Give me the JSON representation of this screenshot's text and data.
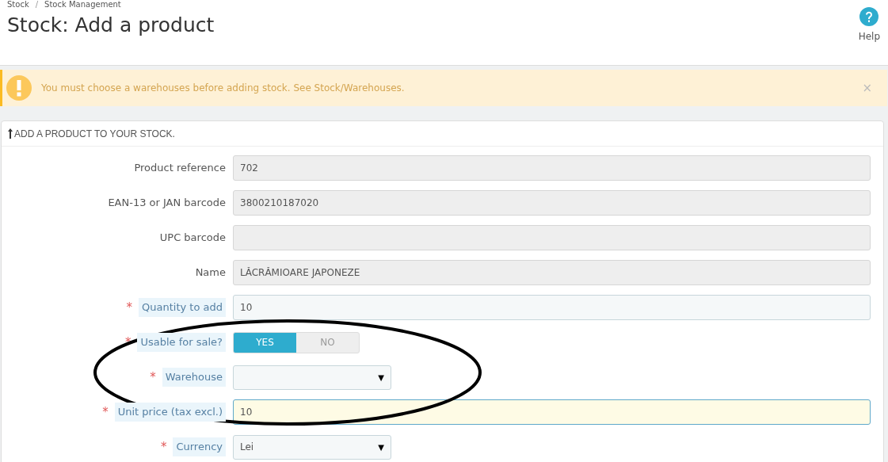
{
  "breadcrumb": [
    "Stock",
    "Stock Management"
  ],
  "breadcrumb_separator": "/",
  "required_mark": "*",
  "page_title": "Stock: Add a product",
  "help": {
    "label": "Help"
  },
  "alert": {
    "message": "You must choose a warehouses before adding stock. See Stock/Warehouses.",
    "close": "×"
  },
  "panel": {
    "title": "ADD A PRODUCT TO YOUR STOCK.",
    "fields": [
      {
        "kind": "text",
        "label": "Product reference",
        "required": false,
        "disabled": true,
        "focused": false,
        "value": "702"
      },
      {
        "kind": "text",
        "label": "EAN-13 or JAN barcode",
        "required": false,
        "disabled": true,
        "focused": false,
        "value": "3800210187020"
      },
      {
        "kind": "text",
        "label": "UPC barcode",
        "required": false,
        "disabled": true,
        "focused": false
      },
      {
        "kind": "text",
        "label": "Name",
        "required": false,
        "disabled": true,
        "focused": false,
        "value": "LĂCRĂMIOARE JAPONEZE"
      },
      {
        "kind": "text",
        "label": "Quantity to add",
        "required": true,
        "disabled": false,
        "focused": false,
        "value": "10"
      },
      {
        "kind": "switch",
        "label": "Usable for sale?",
        "required": true,
        "options": [
          {
            "label": "YES",
            "selected": true
          },
          {
            "label": "NO",
            "selected": false
          }
        ]
      },
      {
        "kind": "select",
        "label": "Warehouse",
        "required": true,
        "caret": "▼"
      },
      {
        "kind": "text",
        "label": "Unit price (tax excl.)",
        "required": true,
        "disabled": false,
        "focused": true,
        "value": "10"
      },
      {
        "kind": "select",
        "label": "Currency",
        "required": true,
        "value": "Lei",
        "caret": "▼"
      }
    ]
  }
}
